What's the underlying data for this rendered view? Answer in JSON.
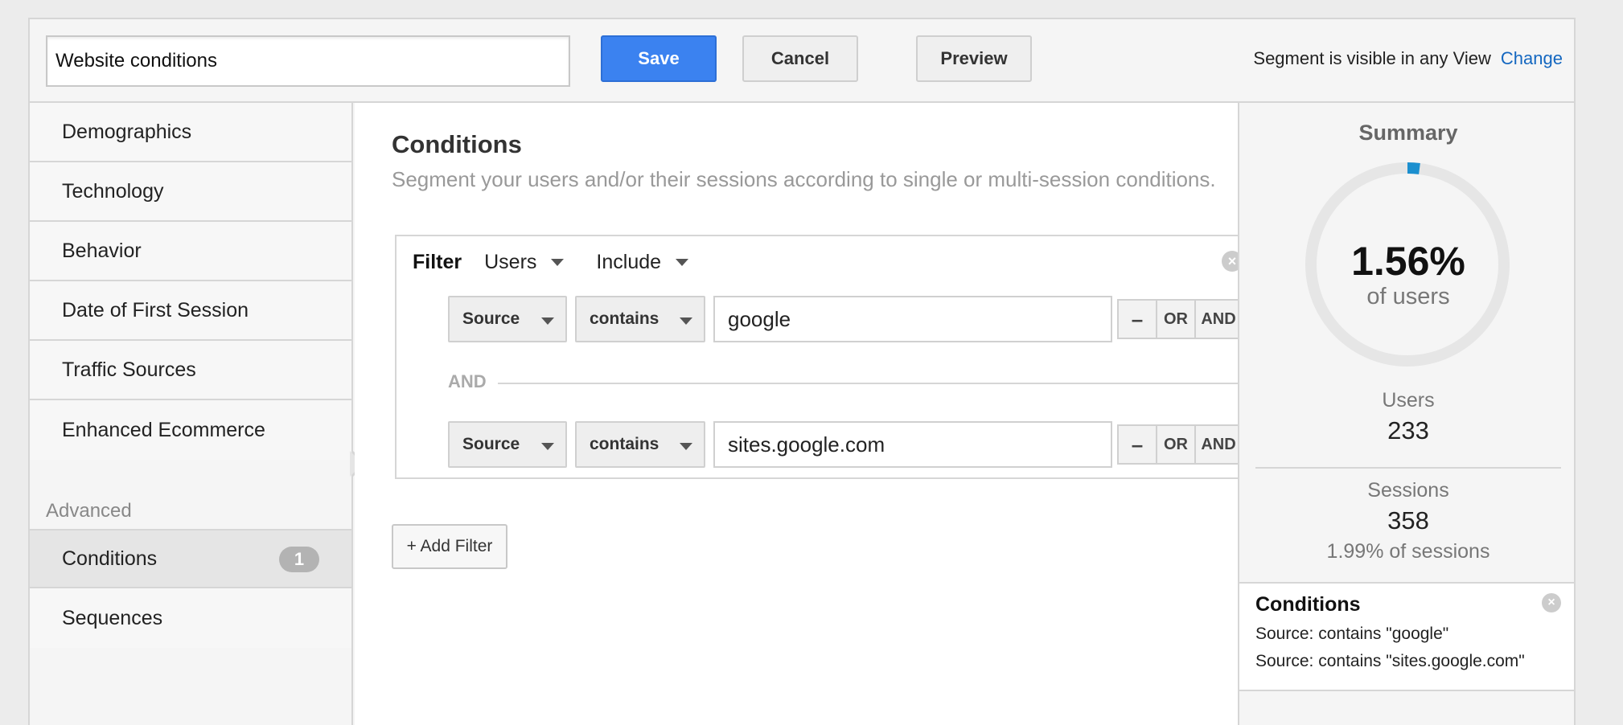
{
  "header": {
    "segment_name": "Website conditions",
    "save_label": "Save",
    "cancel_label": "Cancel",
    "preview_label": "Preview",
    "visibility_text": "Segment is visible in any View",
    "change_label": "Change"
  },
  "sidebar": {
    "items": [
      {
        "label": "Demographics"
      },
      {
        "label": "Technology"
      },
      {
        "label": "Behavior"
      },
      {
        "label": "Date of First Session"
      },
      {
        "label": "Traffic Sources"
      },
      {
        "label": "Enhanced Ecommerce"
      }
    ],
    "advanced_label": "Advanced",
    "advanced_items": [
      {
        "label": "Conditions",
        "badge": "1",
        "active": true
      },
      {
        "label": "Sequences"
      }
    ]
  },
  "main": {
    "title": "Conditions",
    "description": "Segment your users and/or their sessions according to single or multi-session conditions.",
    "filter": {
      "label": "Filter",
      "scope": "Users",
      "mode": "Include",
      "rows": [
        {
          "dimension": "Source",
          "operator": "contains",
          "value": "google"
        },
        {
          "dimension": "Source",
          "operator": "contains",
          "value": "sites.google.com"
        }
      ],
      "minus_label": "–",
      "or_label": "OR",
      "and_label": "AND",
      "separator_label": "AND"
    },
    "add_filter_label": "+ Add Filter"
  },
  "summary": {
    "title": "Summary",
    "percent": "1.56%",
    "percent_value": 1.56,
    "percent_label": "of users",
    "users_label": "Users",
    "users_value": "233",
    "sessions_label": "Sessions",
    "sessions_value": "358",
    "sessions_pct": "1.99% of sessions",
    "conditions_title": "Conditions",
    "conditions_lines": [
      "Source: contains \"google\"",
      "Source: contains \"sites.google.com\""
    ],
    "ring_color": "#e6e6e6",
    "accent_color": "#1b8fcf"
  }
}
